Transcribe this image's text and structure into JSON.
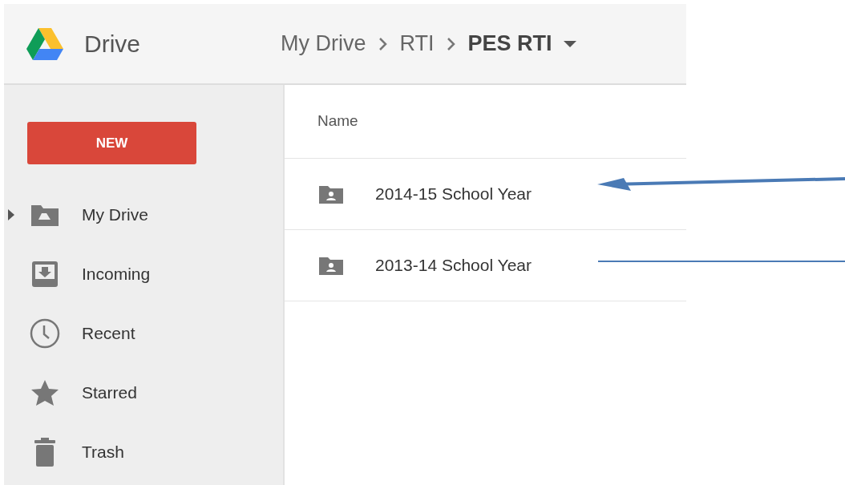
{
  "header": {
    "app_name": "Drive",
    "breadcrumb": [
      {
        "label": "My Drive",
        "current": false
      },
      {
        "label": "RTI",
        "current": false
      },
      {
        "label": "PES RTI",
        "current": true
      }
    ]
  },
  "sidebar": {
    "new_button": "NEW",
    "items": [
      {
        "label": "My Drive",
        "expandable": true
      },
      {
        "label": "Incoming",
        "expandable": false
      },
      {
        "label": "Recent",
        "expandable": false
      },
      {
        "label": "Starred",
        "expandable": false
      },
      {
        "label": "Trash",
        "expandable": false
      }
    ]
  },
  "file_list": {
    "columns": [
      "Name"
    ],
    "rows": [
      {
        "name": "2014-15 School Year"
      },
      {
        "name": "2013-14 School Year"
      }
    ]
  }
}
